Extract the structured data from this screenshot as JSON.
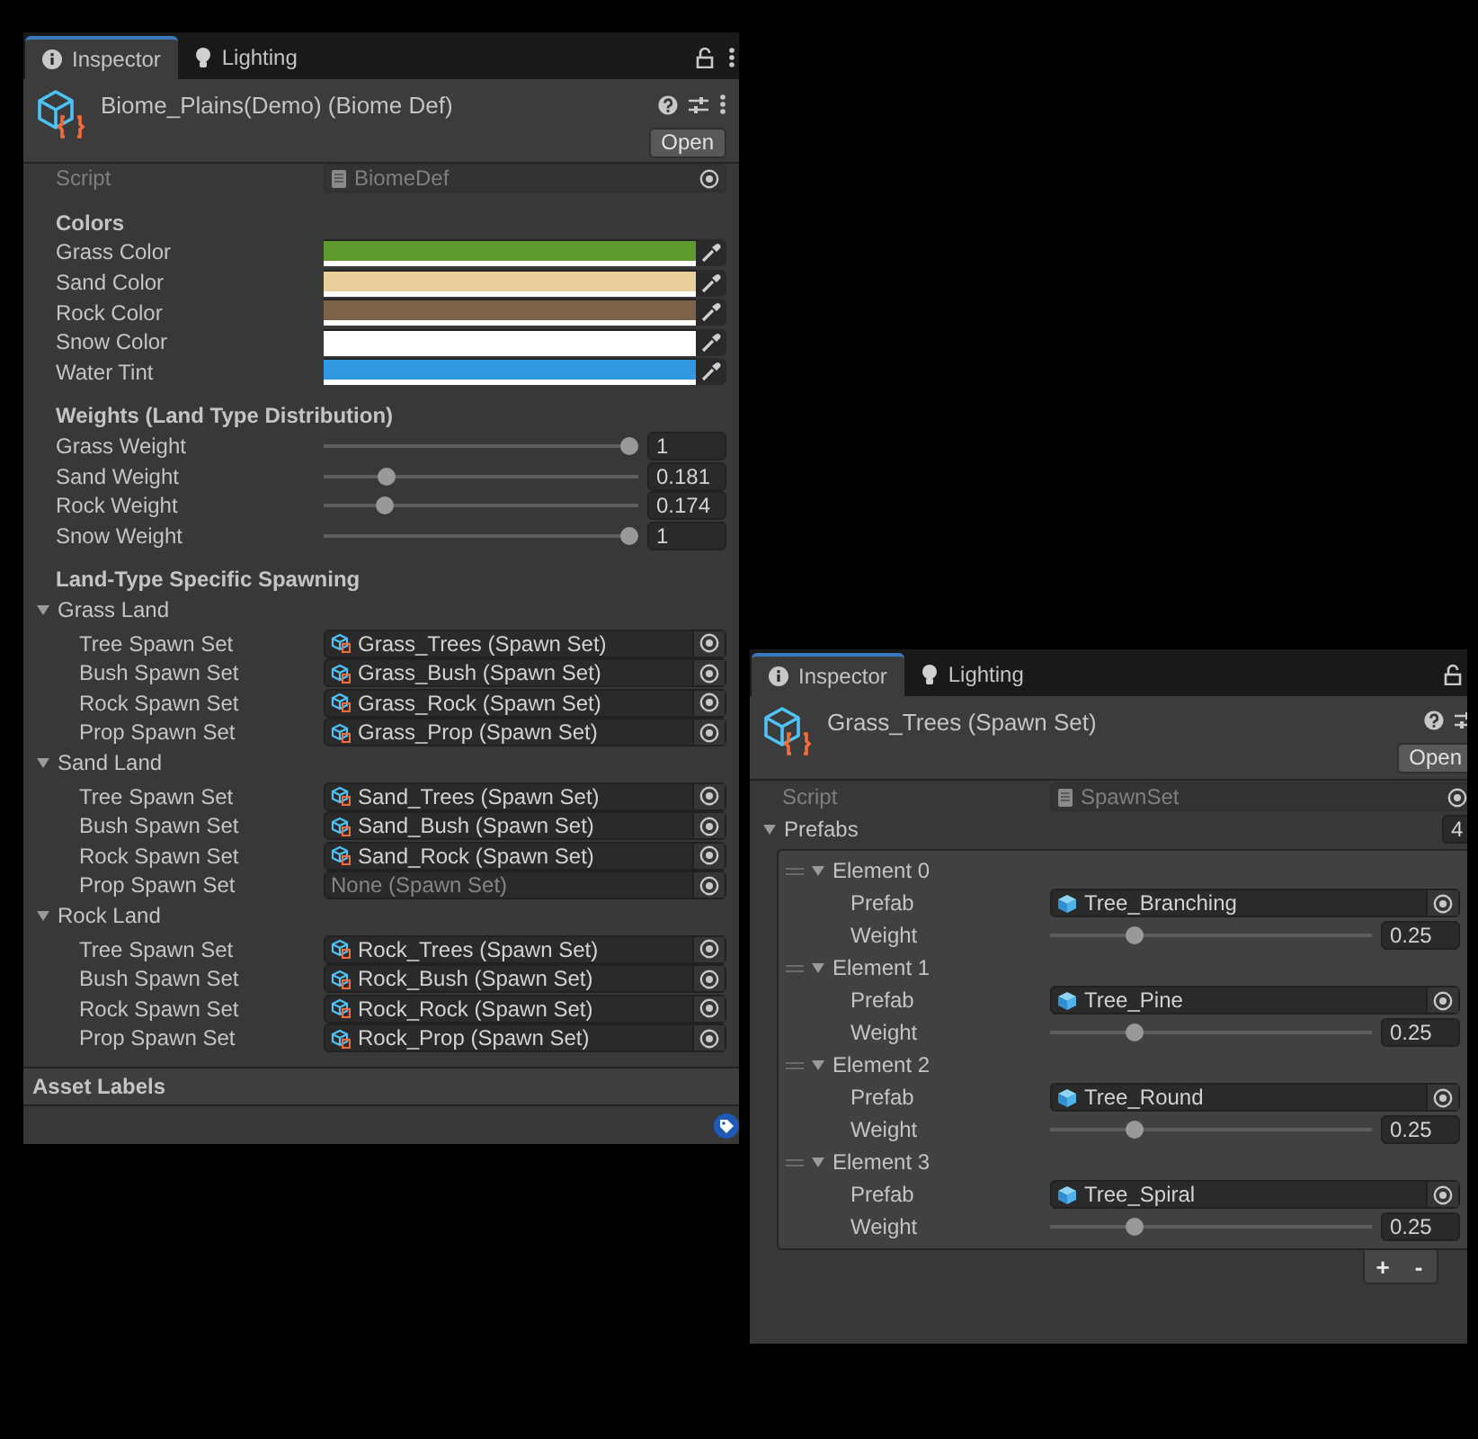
{
  "windows": [
    {
      "kind": "biome",
      "tabs": [
        {
          "label": "Inspector",
          "selected": true
        },
        {
          "label": "Lighting",
          "selected": false
        }
      ],
      "title": "Biome_Plains(Demo) (Biome Def)",
      "open_button": "Open",
      "rows": [
        {
          "kind": "script",
          "label": "Script",
          "value": "BiomeDef"
        },
        {
          "kind": "heading",
          "text": "Colors"
        },
        {
          "kind": "color",
          "label": "Grass Color",
          "color": "#5f9a2e"
        },
        {
          "kind": "color",
          "label": "Sand Color",
          "color": "#e8cf9c"
        },
        {
          "kind": "color",
          "label": "Rock Color",
          "color": "#7d6249"
        },
        {
          "kind": "color",
          "label": "Snow Color",
          "color": "#ffffff"
        },
        {
          "kind": "color",
          "label": "Water Tint",
          "color": "#2f98e0"
        },
        {
          "kind": "heading",
          "text": "Weights (Land Type Distribution)"
        },
        {
          "kind": "slider",
          "label": "Grass Weight",
          "level": 1,
          "value": "1"
        },
        {
          "kind": "slider",
          "label": "Sand Weight",
          "level": 0.181,
          "value": "0.181"
        },
        {
          "kind": "slider",
          "label": "Rock Weight",
          "level": 0.174,
          "value": "0.174"
        },
        {
          "kind": "slider",
          "label": "Snow Weight",
          "level": 1,
          "value": "1"
        },
        {
          "kind": "heading",
          "text": "Land-Type Specific Spawning"
        },
        {
          "kind": "foldout",
          "label": "Grass Land",
          "expanded": true,
          "children": [
            {
              "kind": "asset",
              "label": "Tree Spawn Set",
              "value": "Grass_Trees (Spawn Set)",
              "empty": false
            },
            {
              "kind": "asset",
              "label": "Bush Spawn Set",
              "value": "Grass_Bush (Spawn Set)",
              "empty": false
            },
            {
              "kind": "asset",
              "label": "Rock Spawn Set",
              "value": "Grass_Rock (Spawn Set)",
              "empty": false
            },
            {
              "kind": "asset",
              "label": "Prop Spawn Set",
              "value": "Grass_Prop (Spawn Set)",
              "empty": false
            }
          ]
        },
        {
          "kind": "foldout",
          "label": "Sand Land",
          "expanded": true,
          "children": [
            {
              "kind": "asset",
              "label": "Tree Spawn Set",
              "value": "Sand_Trees (Spawn Set)",
              "empty": false
            },
            {
              "kind": "asset",
              "label": "Bush Spawn Set",
              "value": "Sand_Bush (Spawn Set)",
              "empty": false
            },
            {
              "kind": "asset",
              "label": "Rock Spawn Set",
              "value": "Sand_Rock (Spawn Set)",
              "empty": false
            },
            {
              "kind": "asset",
              "label": "Prop Spawn Set",
              "value": "None (Spawn Set)",
              "empty": true
            }
          ]
        },
        {
          "kind": "foldout",
          "label": "Rock Land",
          "expanded": true,
          "children": [
            {
              "kind": "asset",
              "label": "Tree Spawn Set",
              "value": "Rock_Trees (Spawn Set)",
              "empty": false
            },
            {
              "kind": "asset",
              "label": "Bush Spawn Set",
              "value": "Rock_Bush (Spawn Set)",
              "empty": false
            },
            {
              "kind": "asset",
              "label": "Rock Spawn Set",
              "value": "Rock_Rock (Spawn Set)",
              "empty": false
            },
            {
              "kind": "asset",
              "label": "Prop Spawn Set",
              "value": "Rock_Prop (Spawn Set)",
              "empty": false
            }
          ]
        }
      ],
      "asset_labels": "Asset Labels"
    },
    {
      "kind": "spawn_set",
      "tabs": [
        {
          "label": "Inspector",
          "selected": true
        },
        {
          "label": "Lighting",
          "selected": false
        }
      ],
      "title": "Grass_Trees (Spawn Set)",
      "open_button": "Open",
      "rows": [
        {
          "kind": "script",
          "label": "Script",
          "value": "SpawnSet"
        },
        {
          "kind": "list",
          "label": "Prefabs",
          "expanded": true,
          "count": "4",
          "buttons": [
            "+",
            "-"
          ],
          "elements": [
            {
              "label": "Element 0",
              "expanded": true,
              "children": [
                {
                  "kind": "prefab",
                  "label": "Prefab",
                  "value": "Tree_Branching",
                  "empty": false
                },
                {
                  "kind": "slider",
                  "label": "Weight",
                  "level": 0.25,
                  "value": "0.25"
                }
              ]
            },
            {
              "label": "Element 1",
              "expanded": true,
              "children": [
                {
                  "kind": "prefab",
                  "label": "Prefab",
                  "value": "Tree_Pine",
                  "empty": false
                },
                {
                  "kind": "slider",
                  "label": "Weight",
                  "level": 0.25,
                  "value": "0.25"
                }
              ]
            },
            {
              "label": "Element 2",
              "expanded": true,
              "children": [
                {
                  "kind": "prefab",
                  "label": "Prefab",
                  "value": "Tree_Round",
                  "empty": false
                },
                {
                  "kind": "slider",
                  "label": "Weight",
                  "level": 0.25,
                  "value": "0.25"
                }
              ]
            },
            {
              "label": "Element 3",
              "expanded": true,
              "children": [
                {
                  "kind": "prefab",
                  "label": "Prefab",
                  "value": "Tree_Spiral",
                  "empty": false
                },
                {
                  "kind": "slider",
                  "label": "Weight",
                  "level": 0.25,
                  "value": "0.25"
                }
              ]
            }
          ]
        }
      ]
    }
  ]
}
